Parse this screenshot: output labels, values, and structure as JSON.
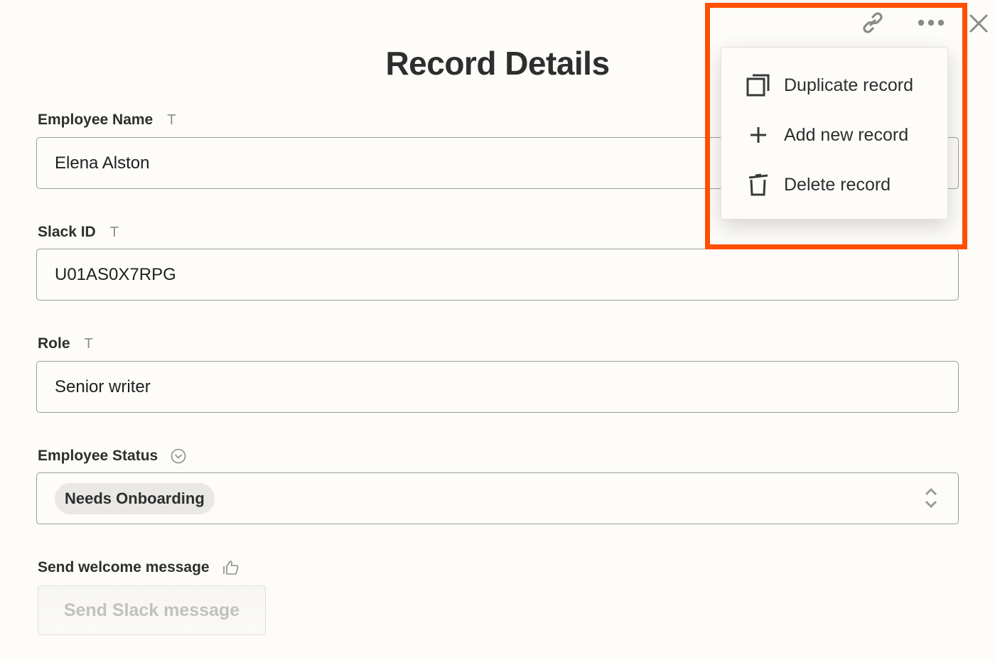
{
  "page": {
    "title": "Record Details"
  },
  "header_actions": {
    "copy_link_icon": "link-icon",
    "more_icon": "more-horizontal-icon",
    "close_icon": "close-icon"
  },
  "dropdown_menu": {
    "items": [
      {
        "label": "Duplicate record",
        "icon": "duplicate-icon"
      },
      {
        "label": "Add new record",
        "icon": "plus-icon"
      },
      {
        "label": "Delete record",
        "icon": "trash-icon"
      }
    ]
  },
  "highlight": {
    "color": "#ff4f00"
  },
  "fields": {
    "employee_name": {
      "label": "Employee Name",
      "type_icon": "T",
      "value": "Elena Alston"
    },
    "slack_id": {
      "label": "Slack ID",
      "type_icon": "T",
      "value": "U01AS0X7RPG"
    },
    "role": {
      "label": "Role",
      "type_icon": "T",
      "value": "Senior writer"
    },
    "employee_status": {
      "label": "Employee Status",
      "type_icon": "dropdown-circle-icon",
      "value": "Needs Onboarding"
    },
    "send_welcome": {
      "label": "Send welcome message",
      "type_icon": "thumbs-up-icon",
      "button_label": "Send Slack message"
    }
  }
}
